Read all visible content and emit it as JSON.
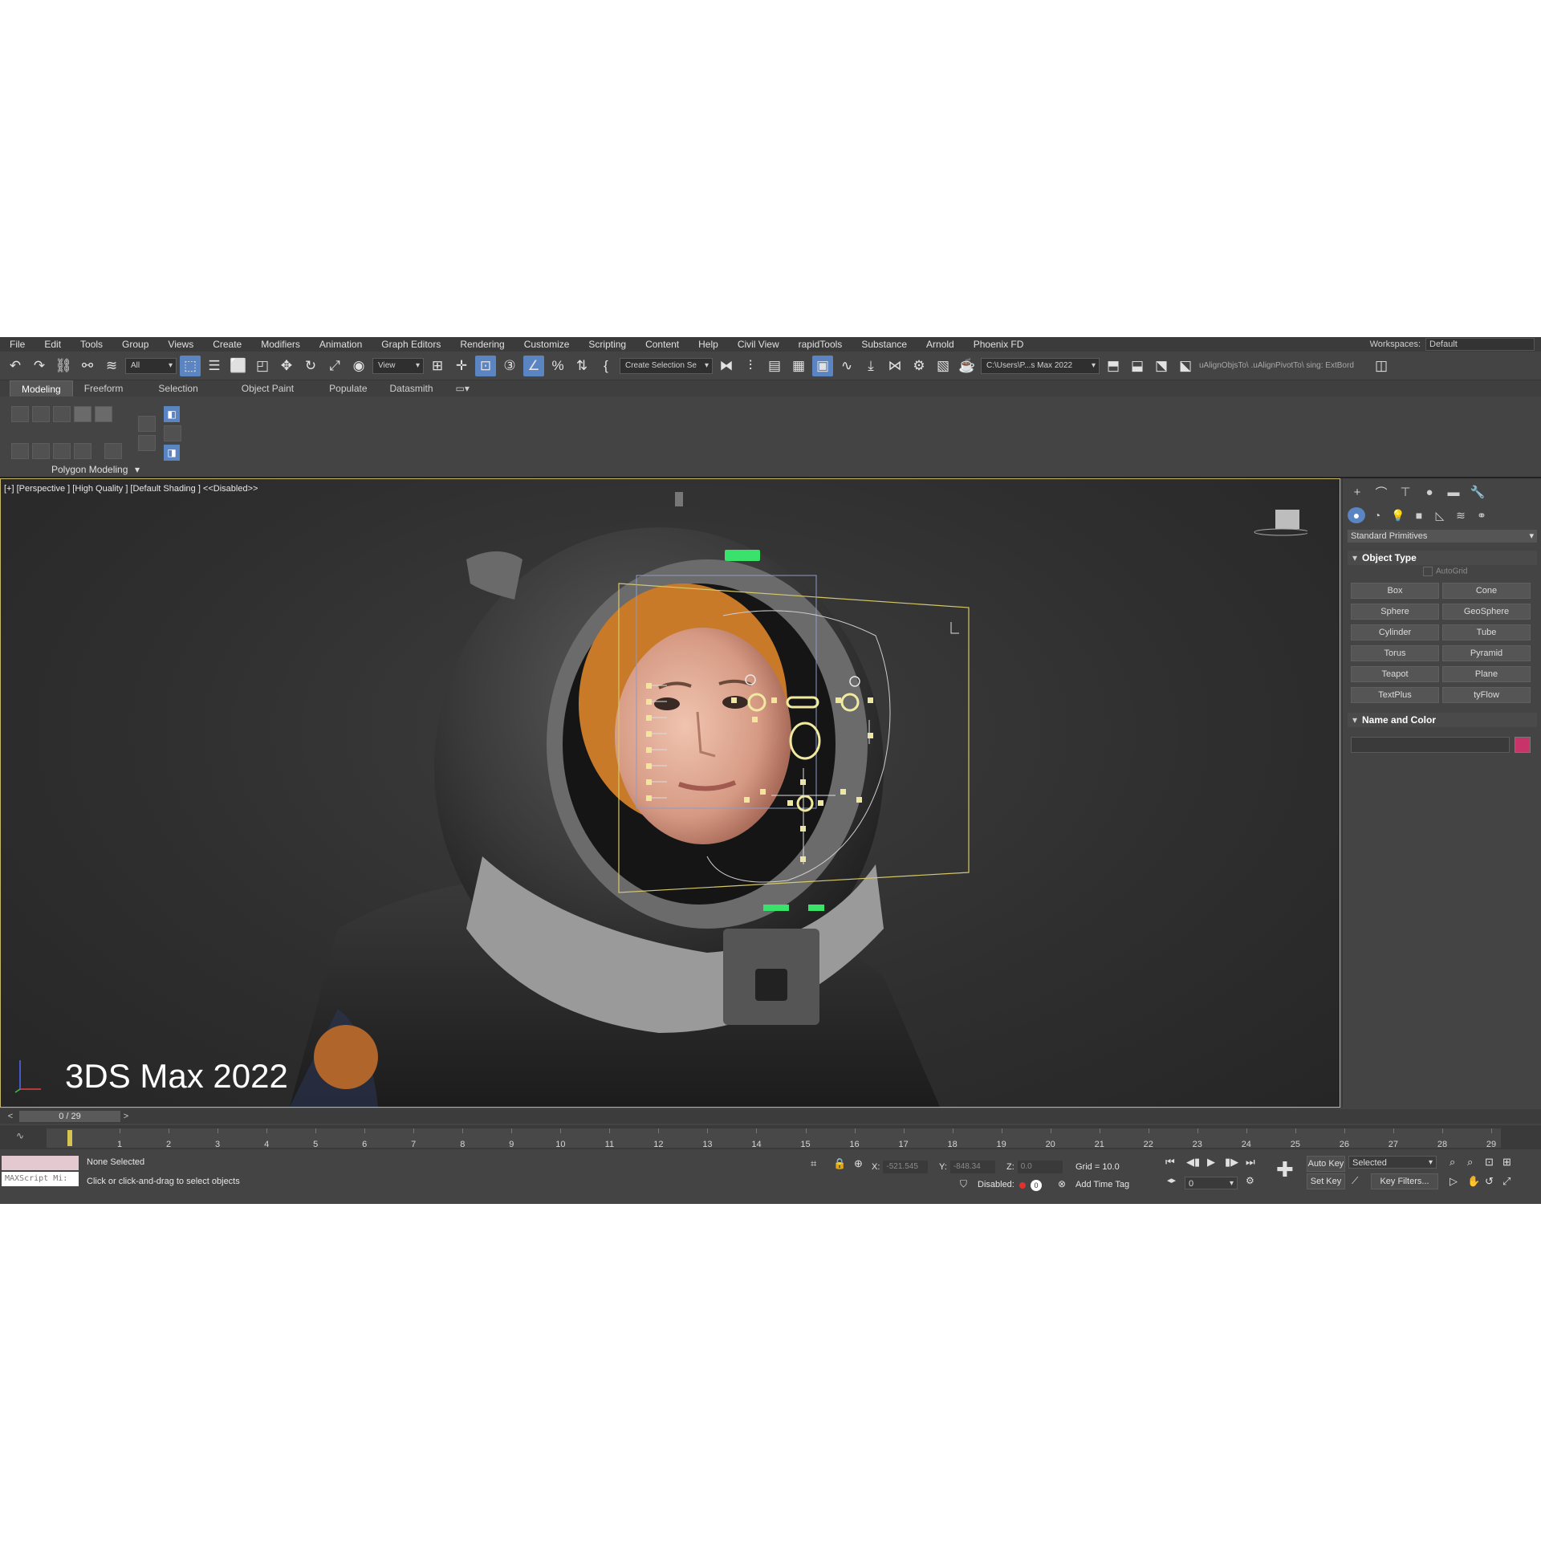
{
  "menu": [
    "File",
    "Edit",
    "Tools",
    "Group",
    "Views",
    "Create",
    "Modifiers",
    "Animation",
    "Graph Editors",
    "Rendering",
    "Customize",
    "Scripting",
    "Content",
    "Help",
    "Civil View",
    "rapidTools",
    "Substance",
    "Arnold",
    "Phoenix FD"
  ],
  "workspace": {
    "label": "Workspaces:",
    "value": "Default"
  },
  "toolbar": {
    "filter": "All",
    "ref_coord": "View",
    "selection_set": "Create Selection Se",
    "project_path": "C:\\Users\\P...s Max 2022",
    "script_text": "uAlignObjsTo\\ .uAlignPivotTo\\ sing: ExtBord"
  },
  "ribbon": {
    "tabs": [
      "Modeling",
      "Freeform",
      "Selection",
      "Object Paint",
      "Populate",
      "Datasmith"
    ],
    "active_tab": "Modeling",
    "panel_label": "Polygon Modeling"
  },
  "viewport": {
    "label": "[+] [Perspective ] [High Quality ] [Default Shading ]  <<Disabled>>",
    "watermark": "3DS Max 2022"
  },
  "command_panel": {
    "category": "Standard Primitives",
    "object_type_title": "Object Type",
    "autogrid": "AutoGrid",
    "buttons": [
      "Box",
      "Cone",
      "Sphere",
      "GeoSphere",
      "Cylinder",
      "Tube",
      "Torus",
      "Pyramid",
      "Teapot",
      "Plane",
      "TextPlus",
      "tyFlow"
    ],
    "name_color_title": "Name and Color",
    "color": "#c8336a"
  },
  "timeline": {
    "frame_display": "0 / 29",
    "ticks": [
      1,
      2,
      3,
      4,
      5,
      6,
      7,
      8,
      9,
      10,
      11,
      12,
      13,
      14,
      15,
      16,
      17,
      18,
      19,
      20,
      21,
      22,
      23,
      24,
      25,
      26,
      27,
      28,
      29
    ]
  },
  "status": {
    "maxscript": "MAXScript Mi:",
    "selection": "None Selected",
    "prompt": "Click or click-and-drag to select objects",
    "x_label": "X:",
    "x_value": "-521.545",
    "y_label": "Y:",
    "y_value": "-848.34",
    "z_label": "Z:",
    "z_value": "0.0",
    "grid": "Grid = 10.0",
    "disabled": "Disabled:",
    "add_time_tag": "Add Time Tag",
    "auto_key": "Auto Key",
    "set_key": "Set Key",
    "key_mode": "Selected",
    "key_filters": "Key Filters...",
    "frame_input": "0"
  }
}
